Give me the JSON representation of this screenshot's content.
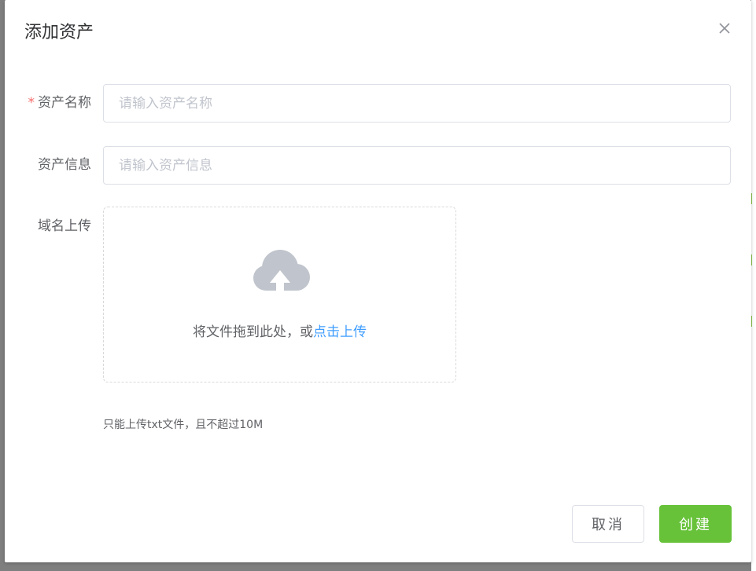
{
  "dialog": {
    "title": "添加资产",
    "close_icon": "close-icon"
  },
  "form": {
    "asset_name": {
      "required_mark": "*",
      "label": "资产名称",
      "placeholder": "请输入资产名称",
      "value": ""
    },
    "asset_info": {
      "label": "资产信息",
      "placeholder": "请输入资产信息",
      "value": ""
    },
    "domain_upload": {
      "label": "域名上传",
      "icon": "cloud-upload-icon",
      "drag_text": "将文件拖到此处，或",
      "link_text": "点击上传",
      "tip": "只能上传txt文件，且不超过10M"
    }
  },
  "footer": {
    "cancel_label": "取消",
    "create_label": "创建"
  },
  "colors": {
    "primary": "#409eff",
    "success": "#67c23a",
    "required": "#f56c6c",
    "icon_gray": "#c0c4cc",
    "overlay": "#7f7f7f"
  }
}
